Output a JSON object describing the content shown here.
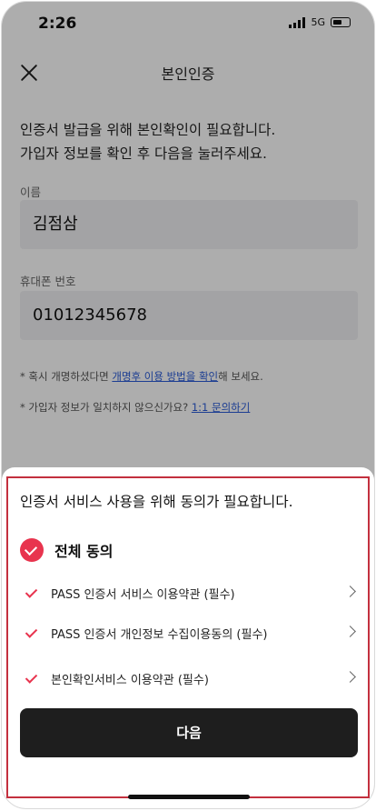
{
  "status_bar": {
    "time": "2:26",
    "network": "5G"
  },
  "header": {
    "title": "본인인증"
  },
  "intro": {
    "line1": "인증서 발급을 위해 본인확인이 필요합니다.",
    "line2": "가입자 정보를 확인 후 다음을 눌러주세요."
  },
  "form": {
    "name_label": "이름",
    "name_value": "김점삼",
    "phone_label": "휴대폰 번호",
    "phone_value": "01012345678"
  },
  "notices": {
    "rename_prefix": "* 혹시 개명하셨다면 ",
    "rename_link": "개명후 이용 방법을 확인",
    "rename_suffix": "해 보세요.",
    "mismatch_prefix": "* 가입자 정보가 일치하지 않으신가요? ",
    "mismatch_link": "1:1 문의하기"
  },
  "sheet": {
    "title": "인증서 서비스 사용을 위해 동의가 필요합니다.",
    "all_agree": "전체 동의",
    "terms": [
      {
        "label": "PASS  인증서 서비스 이용약관 (필수)"
      },
      {
        "label": "PASS 인증서 개인정보 수집이용동의 (필수)"
      },
      {
        "label": "본인확인서비스 이용약관 (필수)"
      }
    ],
    "next_button": "다음"
  },
  "colors": {
    "accent": "#e8344e",
    "button": "#1e1e1e",
    "highlight_border": "#c3303e"
  }
}
